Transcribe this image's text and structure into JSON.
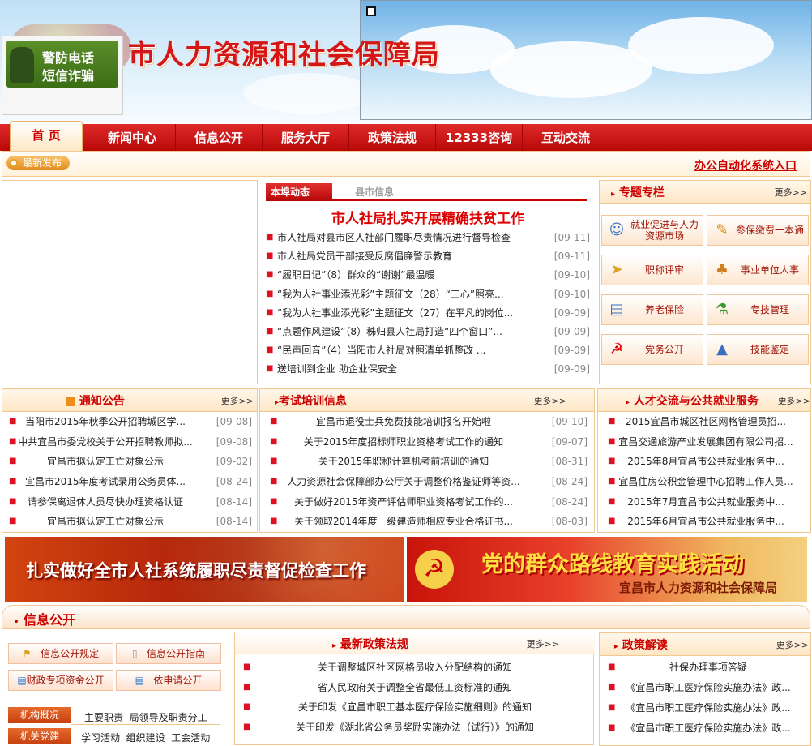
{
  "header": {
    "site_title": "市人力资源和社会保障局",
    "ad_line1": "警防电话",
    "ad_line2": "短信诈骗"
  },
  "nav": [
    "首 页",
    "新闻中心",
    "信息公开",
    "服务大厅",
    "政策法规",
    "12333咨询",
    "互动交流"
  ],
  "subbar": {
    "latest": "最新发布",
    "oa": "办公自动化系统入口"
  },
  "news": {
    "tab_active": "本埠动态",
    "tab_other": "县市信息",
    "headline": "市人社局扎实开展精确扶贫工作",
    "items": [
      {
        "t": "市人社局对县市区人社部门履职尽责情况进行督导检查",
        "d": "[09-11]"
      },
      {
        "t": "市人社局党员干部接受反腐倡廉警示教育",
        "d": "[09-11]"
      },
      {
        "t": "“履职日记”（8）群众的“谢谢”最温暖",
        "d": "[09-10]"
      },
      {
        "t": "“我为人社事业添光彩”主题征文（28）“三心”照亮...",
        "d": "[09-10]"
      },
      {
        "t": "“我为人社事业添光彩”主题征文（27）在平凡的岗位...",
        "d": "[09-09]"
      },
      {
        "t": "“点题作风建设”（8）秭归县人社局打造“四个窗口”...",
        "d": "[09-09]"
      },
      {
        "t": "“民声回音”（4）当阳市人社局对照清单抓整改 ...",
        "d": "[09-09]"
      },
      {
        "t": "送培训到企业 助企业保安全",
        "d": "[09-09]"
      }
    ]
  },
  "topics": {
    "title": "专题专栏",
    "more": "更多>>",
    "items": [
      {
        "label": "就业促进与人力资源市场",
        "icon": "person-icon"
      },
      {
        "label": "参保缴费一本通",
        "icon": "pen-icon"
      },
      {
        "label": "职称评审",
        "icon": "arrow-icon"
      },
      {
        "label": "事业单位人事",
        "icon": "people-icon"
      },
      {
        "label": "养老保险",
        "icon": "book-icon"
      },
      {
        "label": "专技管理",
        "icon": "flask-icon"
      },
      {
        "label": "党务公开",
        "icon": "party-icon"
      },
      {
        "label": "技能鉴定",
        "icon": "chart-icon"
      }
    ]
  },
  "notice": {
    "title": "通知公告",
    "more": "更多>>",
    "items": [
      {
        "t": "当阳市2015年秋季公开招聘城区学...",
        "d": "[09-08]"
      },
      {
        "t": "中共宜昌市委党校关于公开招聘教师拟...",
        "d": "[09-08]"
      },
      {
        "t": "宜昌市拟认定工亡对象公示",
        "d": "[09-02]"
      },
      {
        "t": "宜昌市2015年度考试录用公务员体...",
        "d": "[08-24]"
      },
      {
        "t": "请参保离退休人员尽快办理资格认证",
        "d": "[08-14]"
      },
      {
        "t": "宜昌市拟认定工亡对象公示",
        "d": "[08-14]"
      }
    ]
  },
  "exam": {
    "title": "考试培训信息",
    "more": "更多>>",
    "items": [
      {
        "t": "宜昌市退役士兵免费技能培训报名开始啦",
        "d": "[09-10]"
      },
      {
        "t": "关于2015年度招标师职业资格考试工作的通知",
        "d": "[09-07]"
      },
      {
        "t": "关于2015年职称计算机考前培训的通知",
        "d": "[08-31]"
      },
      {
        "t": "人力资源社会保障部办公厅关于调整价格鉴证师等资...",
        "d": "[08-24]"
      },
      {
        "t": "关于做好2015年资产评估师职业资格考试工作的...",
        "d": "[08-24]"
      },
      {
        "t": "关于领取2014年度一级建造师相应专业合格证书...",
        "d": "[08-03]"
      }
    ]
  },
  "talent": {
    "title": "人才交流与公共就业服务",
    "more": "更多>>",
    "items": [
      {
        "t": "2015宜昌市城区社区网格管理员招..."
      },
      {
        "t": "宜昌交通旅游产业发展集团有限公司招..."
      },
      {
        "t": "2015年8月宜昌市公共就业服务中..."
      },
      {
        "t": "宜昌住房公积金管理中心招聘工作人员..."
      },
      {
        "t": "2015年7月宜昌市公共就业服务中..."
      },
      {
        "t": "2015年6月宜昌市公共就业服务中..."
      }
    ]
  },
  "banners": {
    "left": "扎实做好全市人社系统履职尽责督促检查工作",
    "right_main": "党的群众路线教育实践活动",
    "right_sub": "宜昌市人力资源和社会保障局"
  },
  "info": {
    "title": "信息公开",
    "buttons": [
      "信息公开规定",
      "信息公开指南",
      "财政专项资金公开",
      "依申请公开"
    ],
    "tag1": "机构概况",
    "tag1_text": "主要职责  局领导及职责分工",
    "tag2": "机关党建",
    "tag2_text": "学习活动  组织建设  工会活动"
  },
  "policy": {
    "title": "最新政策法规",
    "more": "更多>>",
    "items": [
      "关于调整城区社区网格员收入分配结构的通知",
      "省人民政府关于调整全省最低工资标准的通知",
      "关于印发《宜昌市职工基本医疗保险实施细则》的通知",
      "关于印发《湖北省公务员奖励实施办法（试行）》的通知"
    ]
  },
  "interp": {
    "title": "政策解读",
    "more": "更多>>",
    "items": [
      "社保办理事项答疑",
      "《宜昌市职工医疗保险实施办法》政...",
      "《宜昌市职工医疗保险实施办法》政...",
      "《宜昌市职工医疗保险实施办法》政..."
    ]
  }
}
